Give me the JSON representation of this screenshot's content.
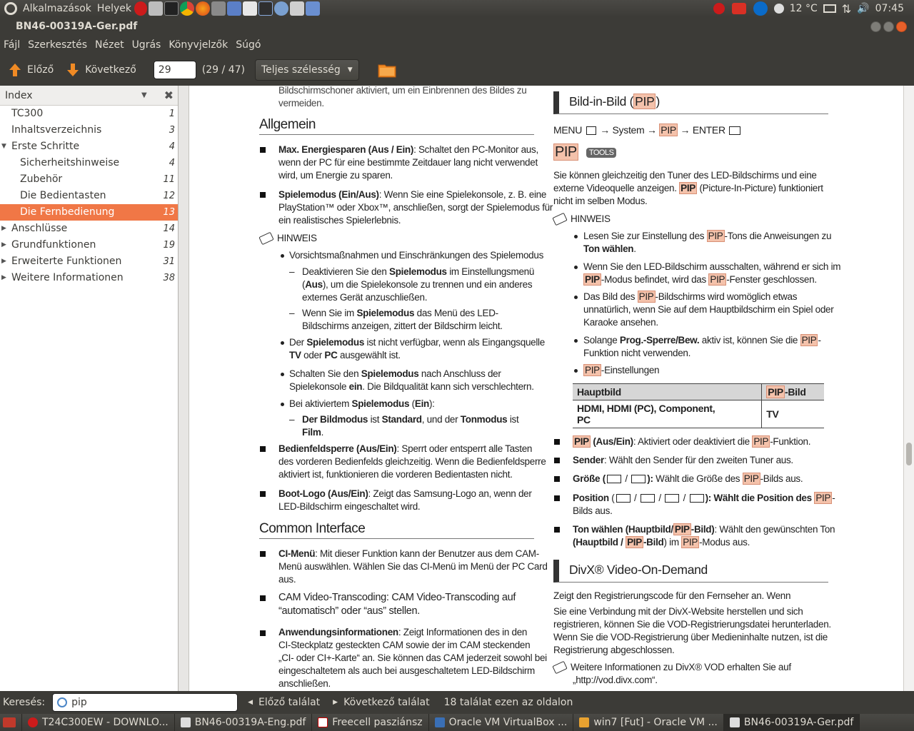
{
  "topbar": {
    "apps": "Alkalmazások",
    "places": "Helyek",
    "temp": "12 °C",
    "time": "07:45"
  },
  "window": {
    "title": "BN46-00319A-Ger.pdf"
  },
  "menu": [
    "Fájl",
    "Szerkesztés",
    "Nézet",
    "Ugrás",
    "Könyvjelzők",
    "Súgó"
  ],
  "toolbar": {
    "prev": "Előző",
    "next": "Következő",
    "page": "29",
    "count": "(29 / 47)",
    "zoom": "Teljes szélesség"
  },
  "sidebar": {
    "title": "Index",
    "items": [
      {
        "label": "TC300",
        "page": "1",
        "level": 1,
        "exp": ""
      },
      {
        "label": "Inhaltsverzeichnis",
        "page": "3",
        "level": 1,
        "exp": ""
      },
      {
        "label": "Erste Schritte",
        "page": "4",
        "level": 1,
        "exp": "▼"
      },
      {
        "label": "Sicherheitshinweise",
        "page": "4",
        "level": 2,
        "exp": ""
      },
      {
        "label": "Zubehör",
        "page": "11",
        "level": 2,
        "exp": ""
      },
      {
        "label": "Die Bedientasten",
        "page": "12",
        "level": 2,
        "exp": ""
      },
      {
        "label": "Die Fernbedienung",
        "page": "13",
        "level": 2,
        "exp": "",
        "selected": true
      },
      {
        "label": "Anschlüsse",
        "page": "14",
        "level": 1,
        "exp": "▶"
      },
      {
        "label": "Grundfunktionen",
        "page": "19",
        "level": 1,
        "exp": "▶"
      },
      {
        "label": "Erweiterte Funktionen",
        "page": "31",
        "level": 1,
        "exp": "▶"
      },
      {
        "label": "Weitere Informationen",
        "page": "38",
        "level": 1,
        "exp": "▶"
      }
    ]
  },
  "pdf": {
    "top_line1": "Bildschirmschoner aktiviert, um ein Einbrennen des Bildes zu",
    "top_line2": "vermeiden.",
    "allgemein": "Allgemein",
    "max_b": "Max. Energiesparen (Aus / Ein)",
    "max_t1": ": Schaltet den PC-Monitor aus,",
    "max_t2": "wenn der PC für eine bestimmte Zeitdauer lang nicht verwendet",
    "max_t3": "wird, um Energie zu sparen.",
    "spiel_b": "Spielemodus (Ein/Aus)",
    "spiel_t1": ": Wenn Sie eine Spielekonsole, z. B. eine",
    "spiel_t2": "PlayStation™ oder Xbox™, anschließen, sorgt der Spielemodus für",
    "spiel_t3": "ein realistisches Spielerlebnis.",
    "hinweis": "HINWEIS",
    "n1": "Vorsichtsmaßnahmen und Einschränkungen des Spielemodus",
    "n1a_1": "Deaktivieren Sie den ",
    "n1a_b": "Spielemodus",
    "n1a_2": " im Einstellungsmenü",
    "n1a_3": "(",
    "n1a_3b": "Aus",
    "n1a_4": "), um die Spielekonsole zu trennen und ein anderes",
    "n1a_5": "externes Gerät anzuschließen.",
    "n1b_1": "Wenn Sie im ",
    "n1b_b": "Spielemodus",
    "n1b_2": " das Menü des LED-",
    "n1b_3": "Bildschirms anzeigen, zittert der Bildschirm leicht.",
    "n2_1": "Der ",
    "n2_b": "Spielemodus",
    "n2_2": " ist nicht verfügbar, wenn als Eingangsquelle",
    "n2_3b": "TV",
    "n2_4": " oder ",
    "n2_5b": "PC",
    "n2_6": " ausgewählt ist.",
    "n3_1": "Schalten Sie den ",
    "n3_b": "Spielemodus",
    "n3_2": " nach Anschluss der",
    "n3_3": "Spielekonsole ",
    "n3_4b": "ein",
    "n3_5": ". Die Bildqualität kann sich verschlechtern.",
    "n4_1": "Bei aktiviertem ",
    "n4_b": "Spielemodus",
    "n4_2": " (",
    "n4_3b": "Ein",
    "n4_4": "):",
    "n4a_b1": "Der Bildmodus",
    "n4a_1": " ist ",
    "n4a_b2": "Standard",
    "n4a_2": ", und der ",
    "n4a_b3": "Tonmodus",
    "n4a_3": " ist",
    "n4a_b4": "Film",
    "n4a_4": ".",
    "bed_b": "Bedienfeldsperre (Aus/Ein)",
    "bed_t1": ": Sperrt oder entsperrt alle Tasten",
    "bed_t2": "des vorderen Bedienfelds gleichzeitig. Wenn die Bedienfeldsperre",
    "bed_t3": "aktiviert ist, funktionieren die vorderen Bedientasten nicht.",
    "boot_b": "Boot-Logo (Aus/Ein)",
    "boot_t1": ": Zeigt das Samsung-Logo an, wenn der",
    "boot_t2": "LED-Bildschirm eingeschaltet wird.",
    "common": "Common Interface",
    "ci_b": "CI-Menü",
    "ci_t1": ": Mit dieser Funktion kann der Benutzer aus dem CAM-",
    "ci_t2": "Menü auswählen. Wählen Sie das CI-Menü im Menü der PC Card",
    "ci_t3": "aus.",
    "cam_b": "CAM Video-Transcoding",
    "cam_t1": ": CAM Video-Transcoding auf",
    "cam_t2": "“automatisch” oder “aus” stellen.",
    "anw_b": "Anwendungsinformationen",
    "anw_t1": ": Zeigt Informationen des in den",
    "anw_t2": "CI-Steckplatz gesteckten CAM sowie der im CAM steckenden",
    "anw_t3": "„CI- oder CI+-Karte“ an. Sie können das CAM jederzeit sowohl bei",
    "anw_t4": "eingeschaltetem als auch bei ausgeschaltetem LED-Bildschirm",
    "anw_t5": "anschließen.",
    "pip_head": "Bild-in-Bild (",
    "pip": "PIP",
    "pip_head_end": ")",
    "menu_path_1": "MENU",
    "menu_path_2": "→ System →",
    "menu_path_3": "→ ENTER",
    "tools": "TOOLS",
    "pip_p1": "Sie können gleichzeitig den Tuner des LED-Bildschirms und eine",
    "pip_p2a": "externe Videoquelle anzeigen. ",
    "pip_p2b": " (Picture-In-Picture) funktioniert",
    "pip_p3": "nicht im selben Modus.",
    "r1a": "Lesen Sie zur Einstellung des ",
    "r1b": "-Tons die Anweisungen zu",
    "r1c": "Ton wählen",
    "r1d": ".",
    "r2a": "Wenn Sie den LED-Bildschirm ausschalten, während er sich im",
    "r2b": "-Modus befindet, wird das ",
    "r2c": "-Fenster geschlossen.",
    "r3a": "Das Bild des ",
    "r3b": "-Bildschirms wird womöglich etwas",
    "r3c": "unnatürlich, wenn Sie auf dem Hauptbildschirm ein Spiel oder",
    "r3d": "Karaoke ansehen.",
    "r4a": "Solange ",
    "r4b": "Prog.-Sperre/Bew.",
    "r4c": " aktiv ist, können Sie die ",
    "r4d": "-",
    "r4e": "Funktion nicht verwenden.",
    "r5": "-Einstellungen",
    "t_h1": "Hauptbild",
    "t_h2": "-Bild",
    "t_c1a": "HDMI, HDMI (PC), Component,",
    "t_c1b": "PC",
    "t_c2": "TV",
    "b1a": " (Aus/Ein)",
    "b1b": ": Aktiviert oder deaktiviert die ",
    "b1c": "-Funktion.",
    "b2a": "Sender",
    "b2b": ": Wählt den Sender für den zweiten Tuner aus.",
    "b3a": "Größe",
    "b3b": " (",
    "b3c": "):",
    "b3d": " Wählt die Größe des ",
    "b3e": "-Bilds aus.",
    "b4a": "Position",
    "b4b": "): Wählt die Position des ",
    "b4c": "-",
    "b4d": "Bilds aus.",
    "b5a": "Ton wählen (Hauptbild/",
    "b5b": "-Bild)",
    "b5c": ": Wählt den gewünschten Ton",
    "b5d": "(Hauptbild / ",
    "b5e": "-Bild",
    "b5f": ") im ",
    "b5g": "-Modus aus.",
    "divx": "DivX® Video-On-Demand",
    "d1": "Zeigt den Registrierungscode für den Fernseher an. Wenn",
    "d2": "Sie eine Verbindung mit der DivX-Website herstellen und sich",
    "d3": "registrieren, können Sie die VOD-Registrierungsdatei herunterladen.",
    "d4": "Wenn Sie die VOD-Registrierung über Medieninhalte nutzen, ist die",
    "d5": "Registrierung abgeschlossen.",
    "d6": "Weitere Informationen zu DivX® VOD erhalten Sie auf",
    "d7": "„http://vod.divx.com“."
  },
  "findbar": {
    "label": "Keresés:",
    "query": "pip",
    "prev": "Előző találat",
    "next": "Következő találat",
    "status": "18 találat ezen az oldalon"
  },
  "taskbar": [
    "T24C300EW - DOWNLO...",
    "BN46-00319A-Eng.pdf",
    "Freecell pasziánsz",
    "Oracle VM VirtualBox ...",
    "win7 [Fut] - Oracle VM ...",
    "BN46-00319A-Ger.pdf"
  ],
  "colors": {
    "accent": "#f07746",
    "highlight": "#f4c2ab"
  }
}
